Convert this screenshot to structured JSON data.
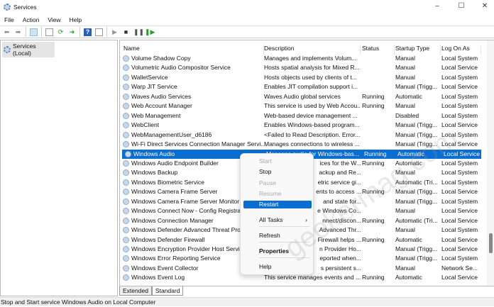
{
  "window": {
    "title": "Services",
    "controls": {
      "minimize": "–",
      "maximize": "☐",
      "close": "✕"
    }
  },
  "menubar": [
    "File",
    "Action",
    "View",
    "Help"
  ],
  "toolbar": {
    "icons": [
      "back-icon",
      "forward-icon",
      "show-hide-console-tree-icon",
      "properties-icon",
      "refresh-icon",
      "export-list-icon",
      "help-icon",
      "show-action-pane-icon",
      "start-service-icon",
      "stop-service-icon",
      "pause-service-icon",
      "restart-service-icon"
    ]
  },
  "tree": {
    "root": "Services (Local)"
  },
  "columns": [
    "Name",
    "Description",
    "Status",
    "Startup Type",
    "Log On As"
  ],
  "rows": [
    {
      "name": "Volume Shadow Copy",
      "desc": "Manages and implements Volum...",
      "status": "",
      "startup": "Manual",
      "logon": "Local System"
    },
    {
      "name": "Volumetric Audio Compositor Service",
      "desc": "Hosts spatial analysis for Mixed R...",
      "status": "",
      "startup": "Manual",
      "logon": "Local Service"
    },
    {
      "name": "WalletService",
      "desc": "Hosts objects used by clients of t...",
      "status": "",
      "startup": "Manual",
      "logon": "Local System"
    },
    {
      "name": "Warp JIT Service",
      "desc": "Enables JIT compilation support i...",
      "status": "",
      "startup": "Manual (Trigg...",
      "logon": "Local Service"
    },
    {
      "name": "Waves Audio Services",
      "desc": "Waves Audio global services",
      "status": "Running",
      "startup": "Automatic",
      "logon": "Local System"
    },
    {
      "name": "Web Account Manager",
      "desc": "This service is used by Web Accou...",
      "status": "Running",
      "startup": "Manual",
      "logon": "Local System"
    },
    {
      "name": "Web Management",
      "desc": "Web-based device management ...",
      "status": "",
      "startup": "Disabled",
      "logon": "Local System"
    },
    {
      "name": "WebClient",
      "desc": "Enables Windows-based program...",
      "status": "",
      "startup": "Manual (Trigg...",
      "logon": "Local Service"
    },
    {
      "name": "WebManagementUser_d6186",
      "desc": "<Failed to Read Description. Error...",
      "status": "",
      "startup": "Manual (Trigg...",
      "logon": "Local System"
    },
    {
      "name": "Wi-Fi Direct Services Connection Manager Servi...",
      "desc": "Manages connections to wireless ...",
      "status": "",
      "startup": "Manual (Trigg...",
      "logon": "Local Service"
    },
    {
      "name": "Windows Audio",
      "desc": "Manages audio for Windows-bas...",
      "status": "Running",
      "startup": "Automatic",
      "logon": "Local Service",
      "selected": true
    },
    {
      "name": "Windows Audio Endpoint Builder",
      "desc": "ices for the W...",
      "status": "Running",
      "startup": "Automatic",
      "logon": "Local System",
      "covered": true
    },
    {
      "name": "Windows Backup",
      "desc": "ackup and Re...",
      "status": "",
      "startup": "Manual",
      "logon": "Local System",
      "covered": true
    },
    {
      "name": "Windows Biometric Service",
      "desc": "etric service gi...",
      "status": "",
      "startup": "Automatic (Tri...",
      "logon": "Local System",
      "covered": true
    },
    {
      "name": "Windows Camera Frame Server",
      "desc": "ents to access ...",
      "status": "Running",
      "startup": "Manual (Trigg...",
      "logon": "Local Service",
      "covered": true
    },
    {
      "name": "Windows Camera Frame Server Monitor",
      "desc": "and state for...",
      "status": "",
      "startup": "Manual (Trigg...",
      "logon": "Local System",
      "covered": true
    },
    {
      "name": "Windows Connect Now - Config Registrar",
      "desc": "e Windows Co...",
      "status": "",
      "startup": "Manual",
      "logon": "Local Service",
      "covered": true
    },
    {
      "name": "Windows Connection Manager",
      "desc": "nnect/discon...",
      "status": "Running",
      "startup": "Automatic (Tri...",
      "logon": "Local Service",
      "covered": true
    },
    {
      "name": "Windows Defender Advanced Threat Prote",
      "desc": "Advanced Thr...",
      "status": "",
      "startup": "Manual",
      "logon": "Local System",
      "covered": true
    },
    {
      "name": "Windows Defender Firewall",
      "desc": "Firewall helps ...",
      "status": "Running",
      "startup": "Automatic",
      "logon": "Local Service",
      "covered": true
    },
    {
      "name": "Windows Encryption Provider Host Service",
      "desc": "n Provider Ho...",
      "status": "",
      "startup": "Manual (Trigg...",
      "logon": "Local Service",
      "covered": true
    },
    {
      "name": "Windows Error Reporting Service",
      "desc": "eported when...",
      "status": "",
      "startup": "Manual (Trigg...",
      "logon": "Local System",
      "covered": true
    },
    {
      "name": "Windows Event Collector",
      "desc": "s persistent s...",
      "status": "",
      "startup": "Manual",
      "logon": "Network Se...",
      "covered": true
    },
    {
      "name": "Windows Event Log",
      "desc": "This service manages events and ...",
      "status": "Running",
      "startup": "Automatic",
      "logon": "Local Service"
    }
  ],
  "context_menu": [
    {
      "label": "Start",
      "disabled": true
    },
    {
      "label": "Stop"
    },
    {
      "label": "Pause",
      "disabled": true
    },
    {
      "label": "Resume",
      "disabled": true
    },
    {
      "label": "Restart",
      "highlighted": true
    },
    {
      "label": "All Tasks",
      "submenu": "›"
    },
    {
      "label": "Refresh"
    },
    {
      "label": "Properties",
      "bold": true
    },
    {
      "label": "Help"
    }
  ],
  "tabs": [
    "Extended",
    "Standard"
  ],
  "statusbar": "Stop and Start service Windows Audio on Local Computer",
  "watermark": "geekermag.com",
  "colors": {
    "selection": "#0a6ed1"
  }
}
